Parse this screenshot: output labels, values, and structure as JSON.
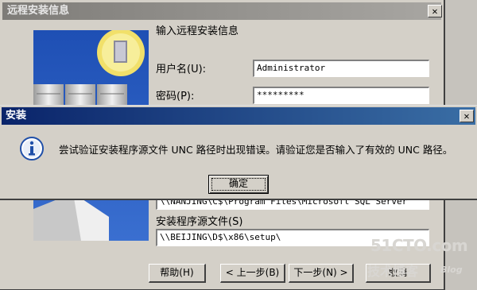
{
  "wizard": {
    "title": "远程安装信息",
    "heading": "输入远程安装信息",
    "username_label": "用户名(U):",
    "username_value": "Administrator",
    "password_label": "密码(P):",
    "password_value": "*********",
    "path_value": "\\\\NANJING\\C$\\Program Files\\Microsoft SQL Server",
    "source_label": "安装程序源文件(S)",
    "source_value": "\\\\BEIJING\\D$\\x86\\setup\\",
    "buttons": {
      "help": "帮助(H)",
      "back": "< 上一步(B)",
      "next": "下一步(N) >",
      "cancel": "取消"
    }
  },
  "dialog": {
    "title": "安装",
    "message": "尝试验证安装程序源文件 UNC 路径时出现错误。请验证您是否输入了有效的 UNC 路径。",
    "ok_label": "确定",
    "icon": "info-icon"
  },
  "watermark": {
    "site": "51CTO.com",
    "tagline": "技术博客",
    "blog": "Blog"
  }
}
